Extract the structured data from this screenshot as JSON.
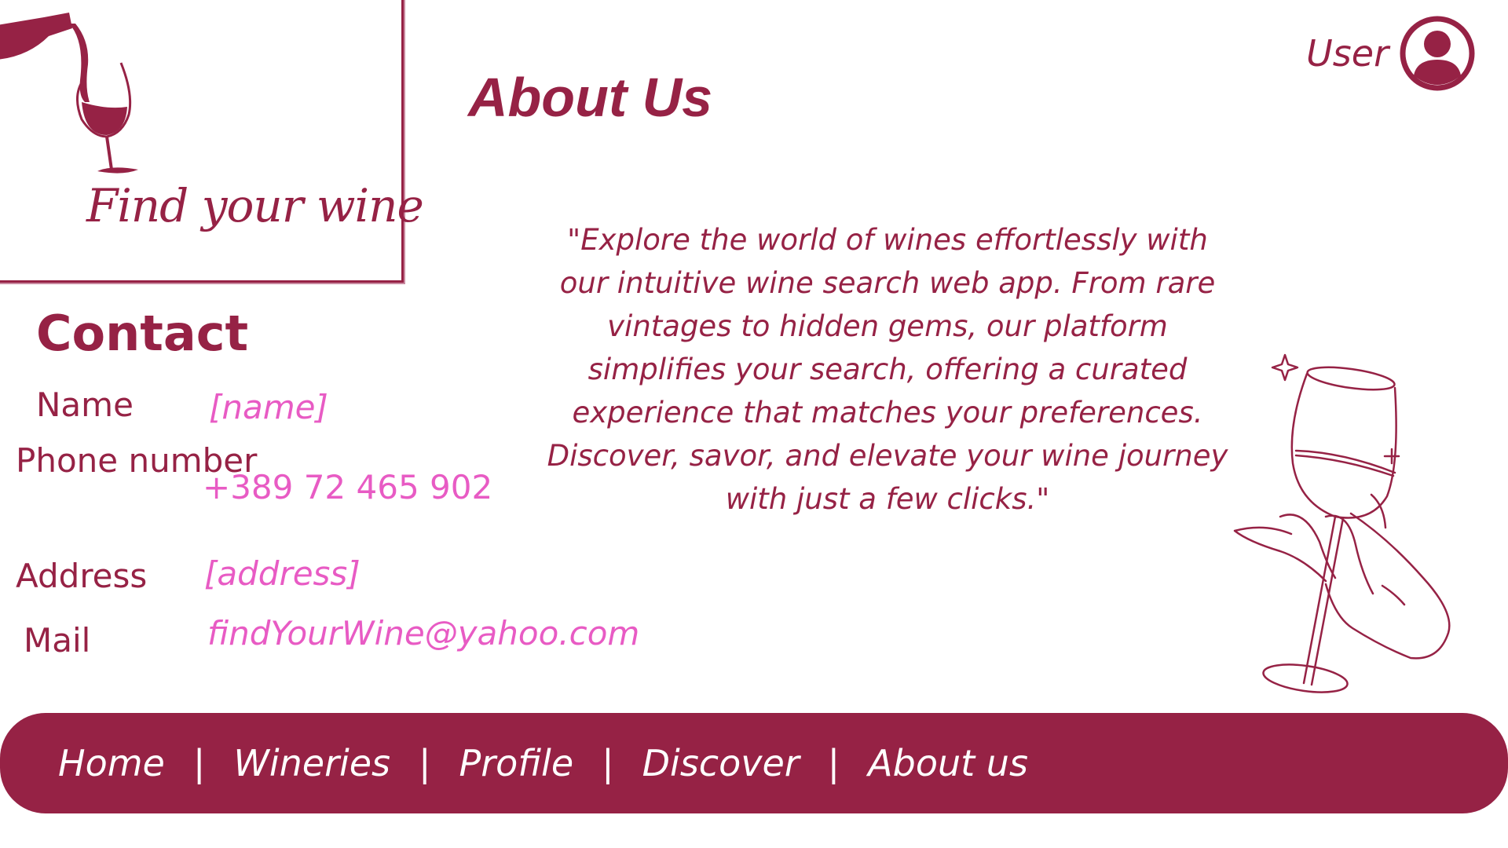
{
  "brand": {
    "logo_text": "Find your wine"
  },
  "header": {
    "title": "About Us",
    "user_label": "User"
  },
  "contact": {
    "title": "Contact",
    "fields": [
      {
        "label": "Name",
        "value": "[name]"
      },
      {
        "label": "Phone number",
        "value": "+389 72 465 902"
      },
      {
        "label": "Address",
        "value": "[address]"
      },
      {
        "label": "Mail",
        "value": "findYourWine@yahoo.com"
      }
    ]
  },
  "about": {
    "quote": "\"Explore the world of wines effortlessly with our intuitive wine search web app. From rare vintages to hidden gems, our platform simplifies your search, offering a curated experience that matches your preferences. Discover, savor, and elevate your wine journey with just a few clicks.\""
  },
  "nav": {
    "items": [
      "Home",
      "Wineries",
      "Profile",
      "Discover",
      "About us"
    ],
    "separator": "|"
  },
  "colors": {
    "primary": "#962245",
    "accent": "#e85bc4",
    "background": "#ffffff"
  },
  "icons": {
    "logo": "wine-bottle-pouring-icon",
    "user": "user-avatar-icon",
    "illustration": "hand-holding-wine-glass-icon"
  }
}
